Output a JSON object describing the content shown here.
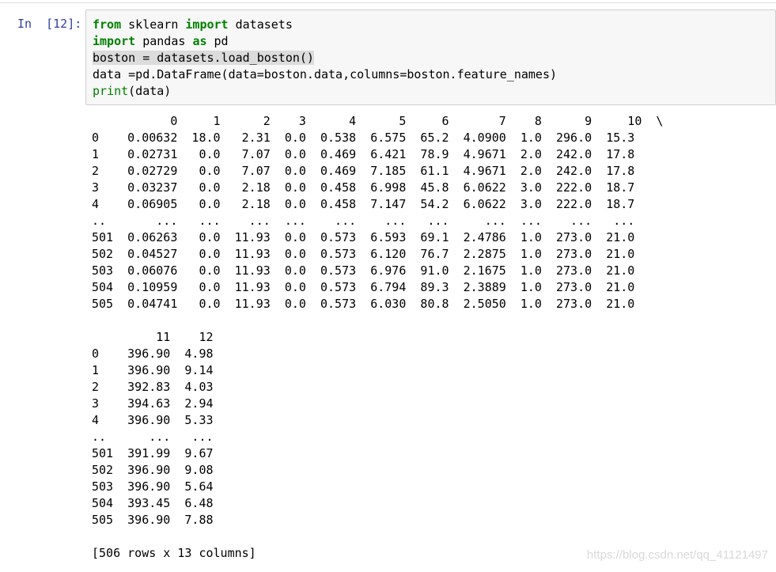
{
  "prompt": "In  [12]:",
  "code_lines": [
    {
      "parts": [
        [
          "kw",
          "from"
        ],
        [
          "t",
          " sklearn "
        ],
        [
          "kw",
          "import"
        ],
        [
          "t",
          " datasets"
        ]
      ]
    },
    {
      "parts": [
        [
          "kw",
          "import"
        ],
        [
          "t",
          " pandas "
        ],
        [
          "kw",
          "as"
        ],
        [
          "t",
          " pd"
        ]
      ]
    },
    {
      "parts": [
        [
          "hl",
          "boston = datasets.load_boston()"
        ]
      ]
    },
    {
      "parts": [
        [
          "t",
          "data =pd.DataFrame(data=boston.data,columns=boston.feature_names)"
        ]
      ]
    },
    {
      "parts": [
        [
          "bi",
          "print"
        ],
        [
          "t",
          "(data)"
        ]
      ]
    }
  ],
  "output_lines": [
    "           0     1      2    3      4      5     6       7    8      9     10  \\",
    "0    0.00632  18.0   2.31  0.0  0.538  6.575  65.2  4.0900  1.0  296.0  15.3",
    "1    0.02731   0.0   7.07  0.0  0.469  6.421  78.9  4.9671  2.0  242.0  17.8",
    "2    0.02729   0.0   7.07  0.0  0.469  7.185  61.1  4.9671  2.0  242.0  17.8",
    "3    0.03237   0.0   2.18  0.0  0.458  6.998  45.8  6.0622  3.0  222.0  18.7",
    "4    0.06905   0.0   2.18  0.0  0.458  7.147  54.2  6.0622  3.0  222.0  18.7",
    "..       ...   ...    ...  ...    ...    ...   ...     ...  ...    ...   ...",
    "501  0.06263   0.0  11.93  0.0  0.573  6.593  69.1  2.4786  1.0  273.0  21.0",
    "502  0.04527   0.0  11.93  0.0  0.573  6.120  76.7  2.2875  1.0  273.0  21.0",
    "503  0.06076   0.0  11.93  0.0  0.573  6.976  91.0  2.1675  1.0  273.0  21.0",
    "504  0.10959   0.0  11.93  0.0  0.573  6.794  89.3  2.3889  1.0  273.0  21.0",
    "505  0.04741   0.0  11.93  0.0  0.573  6.030  80.8  2.5050  1.0  273.0  21.0",
    "",
    "         11    12",
    "0    396.90  4.98",
    "1    396.90  9.14",
    "2    392.83  4.03",
    "3    394.63  2.94",
    "4    396.90  5.33",
    "..      ...   ...",
    "501  391.99  9.67",
    "502  396.90  9.08",
    "503  396.90  5.64",
    "504  393.45  6.48",
    "505  396.90  7.88",
    "",
    "[506 rows x 13 columns]"
  ],
  "watermark": "https://blog.csdn.net/qq_41121497"
}
